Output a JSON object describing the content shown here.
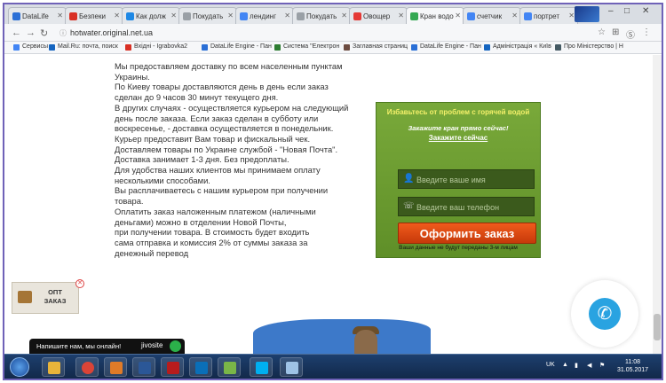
{
  "tabs": [
    {
      "label": "DataLife",
      "color": "#2a6fd6"
    },
    {
      "label": "Безпеки",
      "color": "#d93025"
    },
    {
      "label": "Как долж",
      "color": "#1e88e5"
    },
    {
      "label": "Покудать",
      "color": "#9aa0a6"
    },
    {
      "label": "лендинг",
      "color": "#4285f4"
    },
    {
      "label": "Покудать",
      "color": "#9aa0a6"
    },
    {
      "label": "Овощер",
      "color": "#e53935"
    },
    {
      "label": "Кран водо",
      "color": "#34a853"
    },
    {
      "label": "счетчик",
      "color": "#4285f4"
    },
    {
      "label": "портрет",
      "color": "#4285f4"
    }
  ],
  "address": {
    "url": "hotwater.original.net.ua"
  },
  "bookmarks": [
    {
      "label": "Сервисы",
      "color": "#4285f4"
    },
    {
      "label": "Mail.Ru: почта, поиск",
      "color": "#1565c0"
    },
    {
      "label": "Вхідні - Igrabovka2",
      "color": "#d93025"
    },
    {
      "label": "DataLife Engine - Пан",
      "color": "#2a6fd6"
    },
    {
      "label": "Система \"Електрон",
      "color": "#2e7d32"
    },
    {
      "label": "Заглавная страниц",
      "color": "#6d4c41"
    },
    {
      "label": "DataLife Engine - Пан",
      "color": "#2a6fd6"
    },
    {
      "label": "Адміністрація « Київ",
      "color": "#1565c0"
    },
    {
      "label": "Про Міністерство | Н",
      "color": "#455a64"
    }
  ],
  "content": {
    "lines": [
      "Мы предоставляем доставку по всем населенным пунктам",
      "Украины.",
      "По Киеву товары доставляются день в день если заказ",
      "сделан до 9 часов 30 минут текущего дня.",
      "В других случаях - осуществляется курьером на следующий",
      "день после заказа. Если заказ сделан в субботу или",
      "воскресенье, - доставка осуществляется в понедельник.",
      "Курьер предоставит Вам товар и фискальный чек.",
      "Доставляем товары по Украине службой - \"Новая Почта\".",
      "Доставка занимает 1-3 дня. Без предоплаты.",
      "Для удобства наших клиентов мы принимаем оплату",
      "несколькими способами.",
      "Вы расплачиваетесь с нашим курьером при получении",
      "товара.",
      "Оплатить заказ наложенным платежом (наличными",
      "деньгами) можно в отделении Новой Почты,",
      "при получении товара. В стоимость будет входить",
      "сама отправка и комиссия 2% от суммы заказа за",
      "денежный перевод"
    ]
  },
  "order_form": {
    "heading": "Избавьтесь от проблем с горячей водой",
    "subheading": "Закажите кран прямо сейчас!",
    "link": "Закажите сейчас",
    "name_placeholder": "Введите ваше имя",
    "phone_placeholder": "Введите ваш телефон",
    "submit_label": "Оформить заказ",
    "note": "Ваши данные не будут переданы 3-м лицам"
  },
  "opt_widget": {
    "label": "ОПТ ЗАКАЗ",
    "close": "✕"
  },
  "chat": {
    "message": "Напишите нам, мы онлайн!",
    "brand": "jivosite"
  },
  "taskbar": {
    "lang": "UK",
    "time": "11:08",
    "date": "31.05.2017"
  },
  "colors": {
    "accent_frame": "#6f62b8",
    "form_green": "#6c9c30",
    "order_button": "#e04a12",
    "chat_blue": "#29a3e1"
  }
}
